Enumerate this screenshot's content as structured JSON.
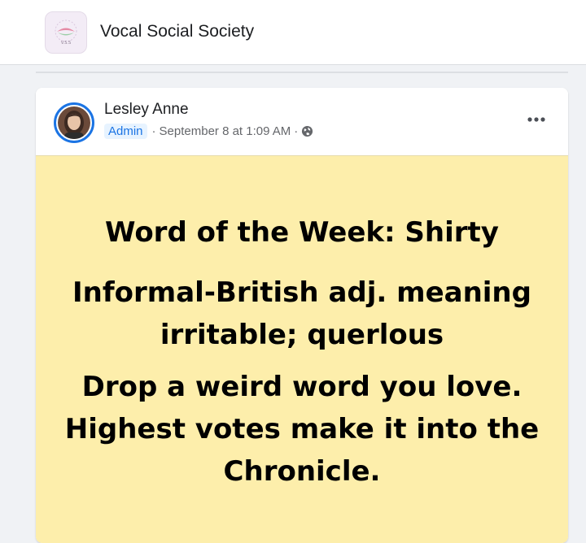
{
  "group": {
    "name": "Vocal Social Society",
    "logo_text": "V.S.S"
  },
  "post": {
    "author": "Lesley Anne",
    "role": "Admin",
    "meta_separator": "·",
    "date": "September 8 at 1:09 AM",
    "visibility_icon": "globe-icon",
    "more_icon": "more-options-icon",
    "background_color": "#fdeeab",
    "text": {
      "line1": "Word of the Week: Shirty",
      "line2": "Informal-British adj. meaning irritable; querlous",
      "line3": "Drop a weird word you love. Highest votes make it into the Chronicle."
    }
  }
}
